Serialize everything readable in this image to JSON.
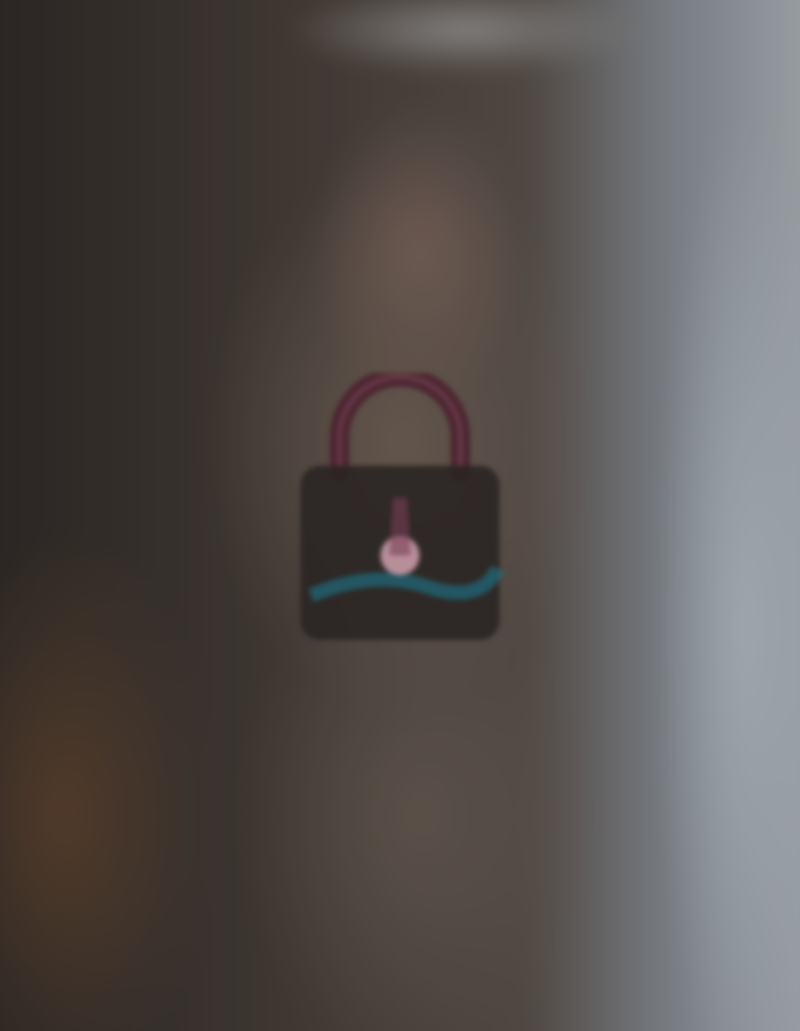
{
  "screen": {
    "state": "locked",
    "lock_icon": "lock-icon",
    "colors": {
      "lock_body": "#2a2524",
      "lock_shackle": "#4a1f2e",
      "keyhole": "#c89aa8",
      "accent_glow": "#1b7f95"
    }
  }
}
